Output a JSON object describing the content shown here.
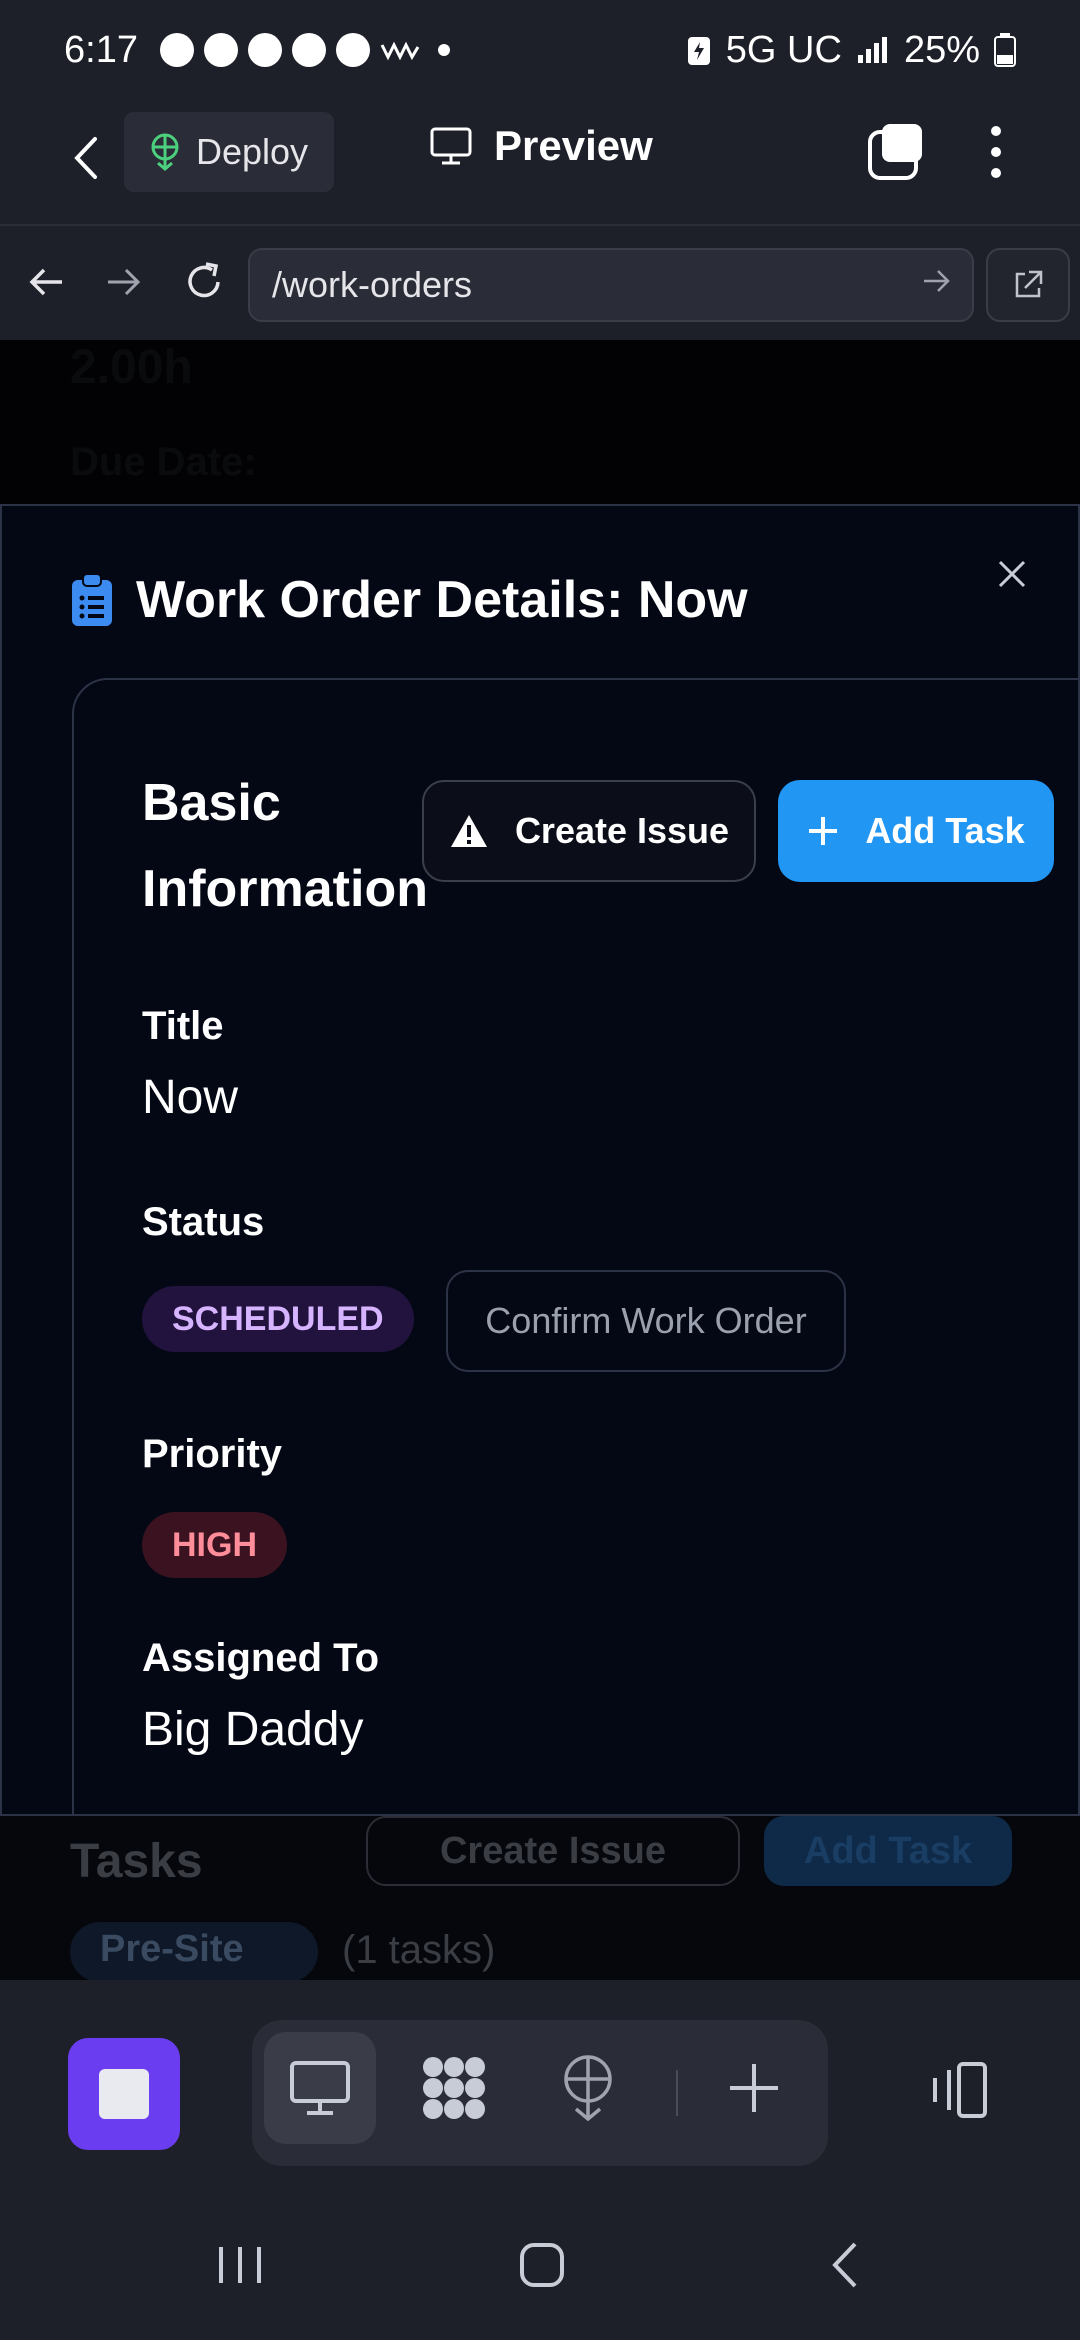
{
  "status_bar": {
    "time": "6:17",
    "network": "5G UC",
    "battery": "25%"
  },
  "app_header": {
    "deploy_label": "Deploy",
    "preview_label": "Preview"
  },
  "browser": {
    "url": "/work-orders"
  },
  "background_page": {
    "hours_text": "2.00h",
    "due_date_label": "Due Date:",
    "tasks_heading": "Tasks",
    "create_issue": "Create Issue",
    "add_task": "Add Task",
    "group_label": "Pre-Site",
    "task_count": "(1 tasks)"
  },
  "modal": {
    "title": "Work Order Details: Now",
    "card": {
      "heading": "Basic Information",
      "create_issue_label": "Create Issue",
      "add_task_label": "Add Task",
      "title_label": "Title",
      "title_value": "Now",
      "status_label": "Status",
      "status_value": "SCHEDULED",
      "confirm_label": "Confirm Work Order",
      "priority_label": "Priority",
      "priority_value": "HIGH",
      "assigned_label": "Assigned To",
      "assigned_value": "Big Daddy"
    }
  },
  "colors": {
    "accent_blue": "#2196f3",
    "stop_purple": "#6a3ef0",
    "scheduled_bg": "#21133d",
    "high_bg": "#3a1220"
  }
}
